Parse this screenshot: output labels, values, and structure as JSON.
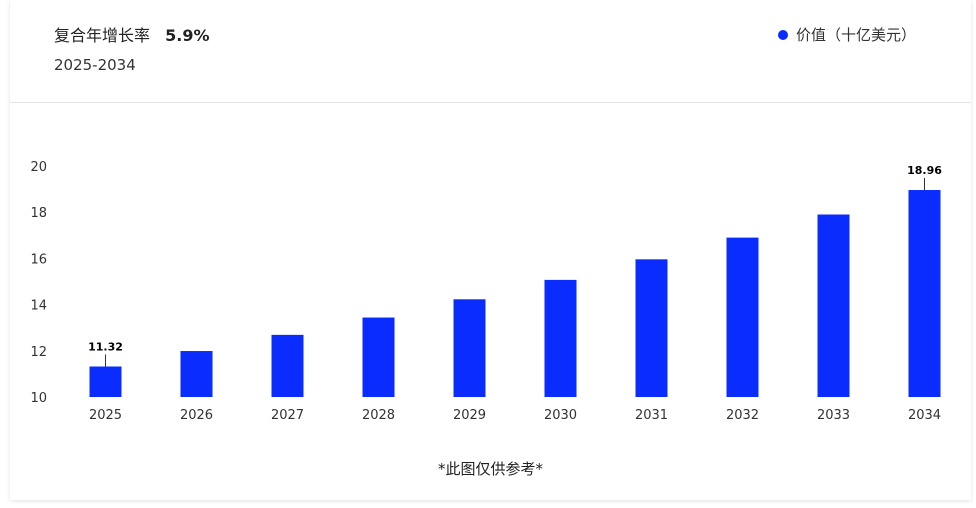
{
  "header": {
    "cagr_label": "复合年增长率",
    "cagr_value": "5.9%",
    "range": "2025-2034"
  },
  "legend": {
    "label": "价值（十亿美元）",
    "color": "#0a2cff"
  },
  "footnote": "*此图仅供参考*",
  "chart_data": {
    "type": "bar",
    "categories": [
      "2025",
      "2026",
      "2027",
      "2028",
      "2029",
      "2030",
      "2031",
      "2032",
      "2033",
      "2034"
    ],
    "series": [
      {
        "name": "价值（十亿美元）",
        "values": [
          11.32,
          11.99,
          12.69,
          13.44,
          14.23,
          15.07,
          15.96,
          16.9,
          17.9,
          18.96
        ]
      }
    ],
    "data_labels": {
      "2025": "11.32",
      "2034": "18.96"
    },
    "ylim": [
      10,
      20
    ],
    "yticks": [
      10,
      12,
      14,
      16,
      18,
      20
    ],
    "color": "#0a2cff",
    "grid": false
  }
}
